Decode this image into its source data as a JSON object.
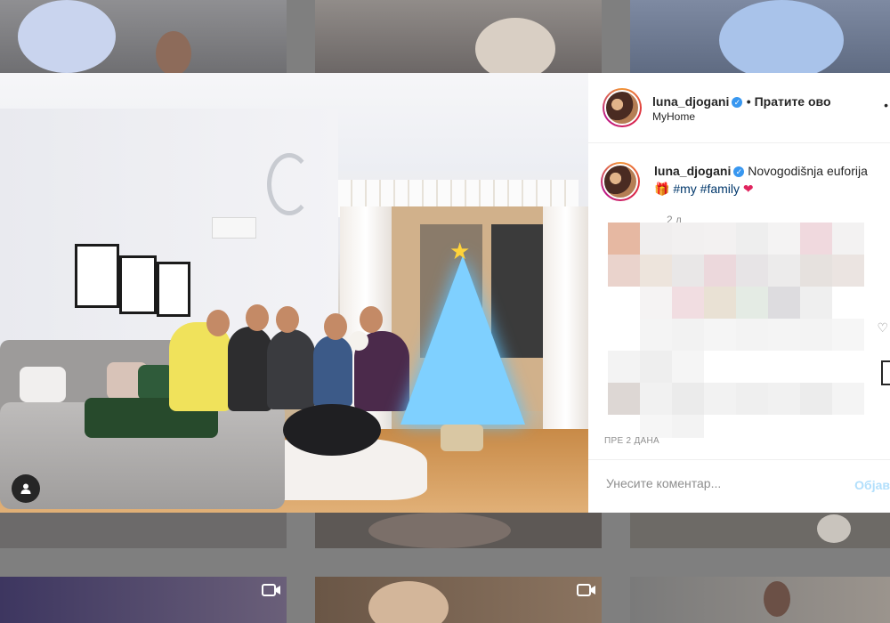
{
  "post": {
    "username": "luna_djogani",
    "follow_label": "• Пратите ово",
    "location": "MyHome",
    "more_label": "•",
    "caption_text": "Novogodišnja euforija",
    "hashtags": [
      "#my",
      "#family"
    ],
    "caption_time": "2 д",
    "date_label": "ПРЕ 2 ДАНА",
    "comment_placeholder": "Унесите коментар...",
    "post_button": "Објав"
  },
  "colors": {
    "accent": "#3897f0",
    "post_button": "#b2dffc",
    "hashtag": "#00376b"
  },
  "icons": [
    "verified-badge-icon",
    "user-tag-icon",
    "gift-emoji-icon",
    "heart-emoji-icon",
    "heart-icon",
    "bookmark-icon",
    "video-icon"
  ]
}
